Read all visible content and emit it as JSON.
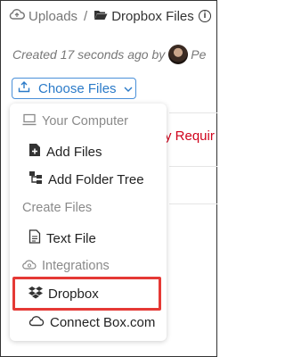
{
  "breadcrumb": {
    "root_label": "Uploads",
    "separator": "/",
    "current_label": "Dropbox Files"
  },
  "info_icon_glyph": "i",
  "created": {
    "text": "Created 17 seconds ago by",
    "user_name_partial": "Pe"
  },
  "choose_button": {
    "label": "Choose Files",
    "accent_color": "#2a7ac8"
  },
  "background": {
    "required_text": "y Requir"
  },
  "menu": {
    "sections": [
      {
        "header": "Your Computer",
        "icon": "computer-icon",
        "items": [
          {
            "label": "Add Files",
            "icon": "file-plus-icon"
          },
          {
            "label": "Add Folder Tree",
            "icon": "folder-tree-icon"
          }
        ]
      },
      {
        "header": "Create Files",
        "icon": "",
        "items": [
          {
            "label": "Text File",
            "icon": "text-file-icon"
          }
        ]
      },
      {
        "header": "Integrations",
        "icon": "integrations-icon",
        "items": [
          {
            "label": "Dropbox",
            "icon": "dropbox-icon"
          },
          {
            "label": "Connect Box.com",
            "icon": "cloud-icon"
          }
        ]
      }
    ]
  },
  "highlight_color": "#e53935"
}
